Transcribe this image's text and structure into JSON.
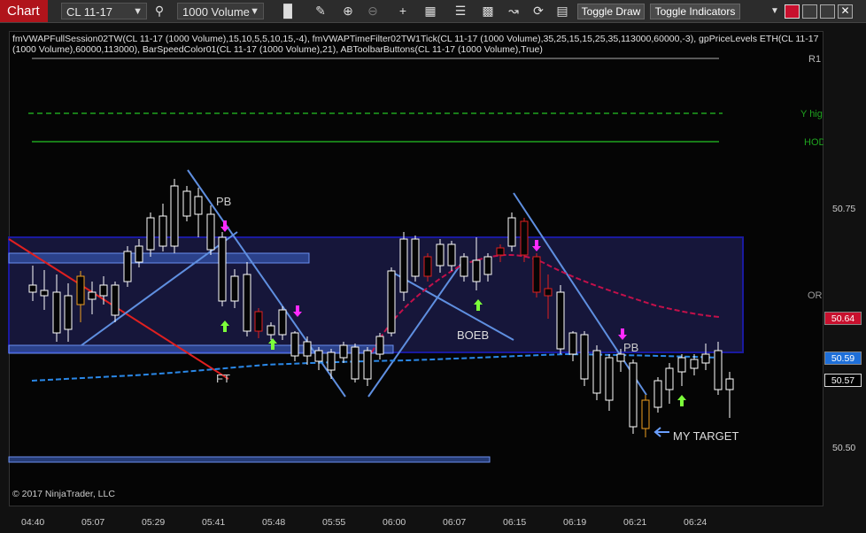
{
  "toolbar": {
    "chart_tab": "Chart",
    "instrument": "CL 11-17",
    "interval": "1000 Volume",
    "toggle_draw": "Toggle Draw",
    "toggle_indicators": "Toggle Indicators"
  },
  "indicators_line1": "fmVWAPFullSession02TW(CL 11-17 (1000 Volume),15,10,5,5,10,15,-4), fmVWAPTimeFilter02TW1Tick(CL 11-17 (1000 Volume),35,25,15,15,25,35,113000,60000,-3), gpPriceLevels ETH(CL 11-17",
  "indicators_line2": "(1000 Volume),60000,113000), BarSpeedColor01(CL 11-17 (1000 Volume),21), ABToolbarButtons(CL 11-17 (1000 Volume),True)",
  "copyright": "© 2017 NinjaTrader, LLC",
  "level_labels": {
    "r1": "R1",
    "y_high": "Y hig",
    "hod": "HOD",
    "or": "OR"
  },
  "annotations": {
    "pb1": "PB",
    "pb2": "PB",
    "boeb": "BOEB",
    "ft": "FT",
    "target": "MY TARGET"
  },
  "price_ticks": [
    "50.75",
    "50.50"
  ],
  "price_markers": {
    "vwap_red": "50.64",
    "vwap_blue": "50.59",
    "last": "50.57"
  },
  "time_ticks": [
    "04:40",
    "05:07",
    "05:29",
    "05:41",
    "05:48",
    "05:55",
    "06:00",
    "06:07",
    "06:15",
    "06:19",
    "06:21",
    "06:24"
  ],
  "colors": {
    "chart_tab": "#b0141b",
    "marker_red": "#c8102e",
    "marker_blue": "#1e6fd9",
    "zone": "#1a1a9a"
  }
}
